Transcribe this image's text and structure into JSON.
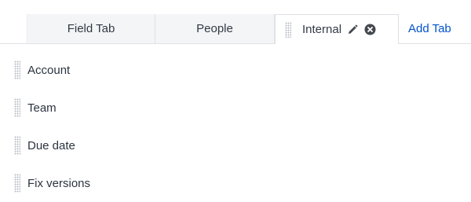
{
  "tabs": [
    {
      "label": "Field Tab"
    },
    {
      "label": "People"
    },
    {
      "label": "Internal",
      "active": true
    }
  ],
  "add_tab_label": "Add Tab",
  "fields": [
    {
      "label": "Account"
    },
    {
      "label": "Team"
    },
    {
      "label": "Due date"
    },
    {
      "label": "Fix versions"
    }
  ],
  "icons": {
    "grip": "drag-handle-icon",
    "edit": "pencil-icon",
    "close": "close-circle-icon"
  },
  "colors": {
    "link": "#0052cc",
    "inactive_tab_bg": "#f4f5f7",
    "border": "#dfe1e6"
  }
}
